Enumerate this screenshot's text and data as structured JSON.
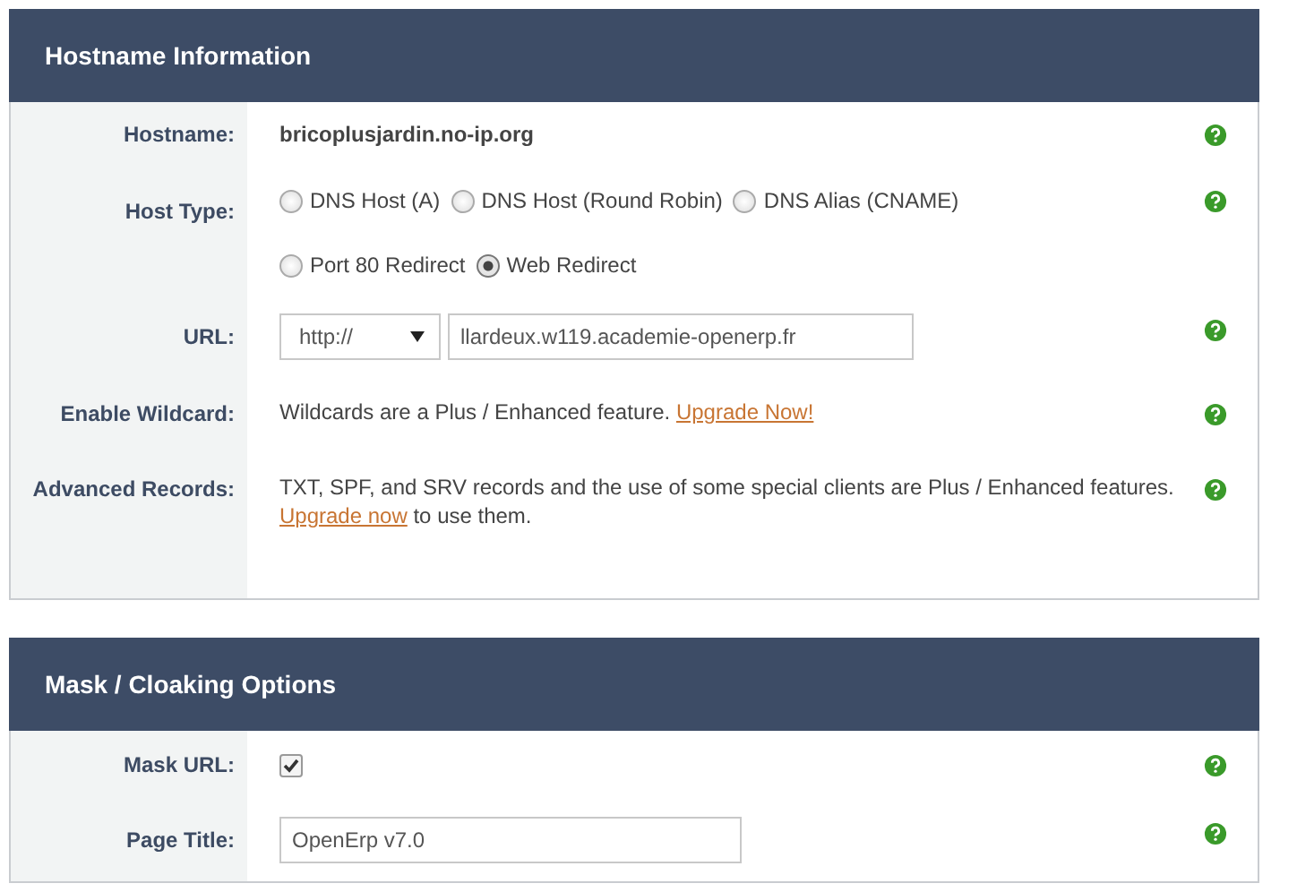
{
  "panels": [
    {
      "title": "Hostname Information",
      "rows": [
        {
          "kind": "text",
          "label": "Hostname:",
          "value": "bricoplusjardin.no-ip.org"
        },
        {
          "kind": "radios",
          "label": "Host Type:",
          "options": [
            {
              "label": "DNS Host (A)",
              "selected": false
            },
            {
              "label": "DNS Host (Round Robin)",
              "selected": false
            },
            {
              "label": "DNS Alias (CNAME)",
              "selected": false
            },
            {
              "label": "Port 80 Redirect",
              "selected": false
            },
            {
              "label": "Web Redirect",
              "selected": true
            }
          ]
        },
        {
          "kind": "url",
          "label": "URL:",
          "protocol": "http://",
          "value": "llardeux.w119.academie-openerp.fr"
        },
        {
          "kind": "notice",
          "label": "Enable Wildcard:",
          "text": "Wildcards are a Plus / Enhanced feature.",
          "link": "Upgrade Now!",
          "after": ""
        },
        {
          "kind": "notice",
          "label": "Advanced Records:",
          "text": "TXT, SPF, and SRV records and the use of some special clients are Plus / Enhanced features.",
          "link": "Upgrade now",
          "after": "to use them."
        }
      ]
    },
    {
      "title": "Mask / Cloaking Options",
      "rows": [
        {
          "kind": "checkbox",
          "label": "Mask URL:",
          "checked": true
        },
        {
          "kind": "input",
          "label": "Page Title:",
          "value": "OpenErp v7.0"
        }
      ]
    }
  ]
}
